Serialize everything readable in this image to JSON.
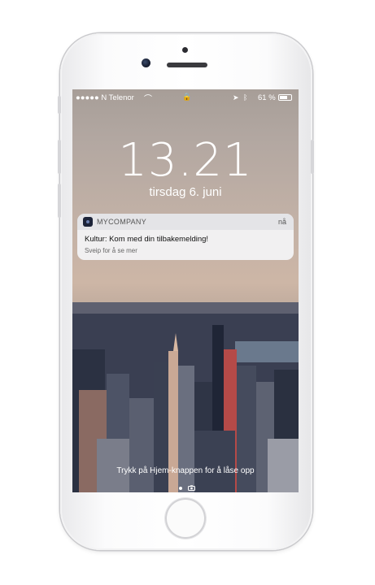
{
  "status_bar": {
    "carrier": "●●●●● N Telenor",
    "battery": "61 %"
  },
  "lock_screen": {
    "time": "13.21",
    "date": "tirsdag 6. juni"
  },
  "notification": {
    "app_name": "MYCOMPANY",
    "time": "nå",
    "title": "Kultur: Kom med din tilbakemelding!",
    "subtitle": "Sveip for å se mer"
  },
  "unlock_hint": "Trykk på Hjem-knappen for å låse opp"
}
